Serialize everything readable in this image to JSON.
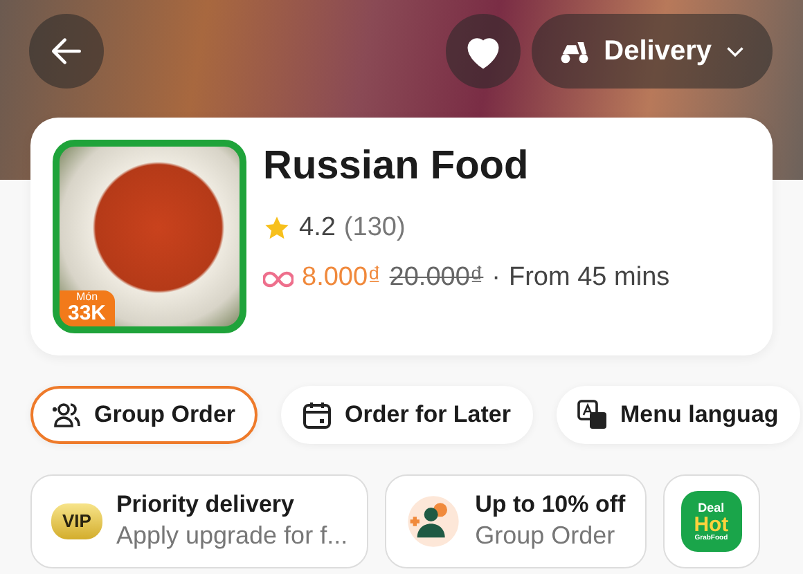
{
  "header": {
    "favorite": {
      "on": true
    },
    "mode": {
      "label": "Delivery"
    }
  },
  "restaurant": {
    "name": "Russian Food",
    "badge": {
      "top": "Món",
      "bottom": "33K"
    },
    "rating": "4.2",
    "reviews": "(130)",
    "price": "8.000₫",
    "old_price": "20.000₫",
    "separator": "·",
    "eta": "From 45 mins"
  },
  "chips": [
    {
      "kind": "group",
      "label": "Group Order",
      "selected": true
    },
    {
      "kind": "calendar",
      "label": "Order for Later",
      "selected": false
    },
    {
      "kind": "language",
      "label": "Menu languag",
      "selected": false
    }
  ],
  "promos": [
    {
      "kind": "vip",
      "icon_text": "VIP",
      "title": "Priority delivery",
      "subtitle": "Apply upgrade for f..."
    },
    {
      "kind": "group",
      "title": "Up to 10% off",
      "subtitle": "Group Order"
    },
    {
      "kind": "deal",
      "icon_text": [
        "Deal",
        "Hot",
        "GrabFood"
      ]
    }
  ]
}
